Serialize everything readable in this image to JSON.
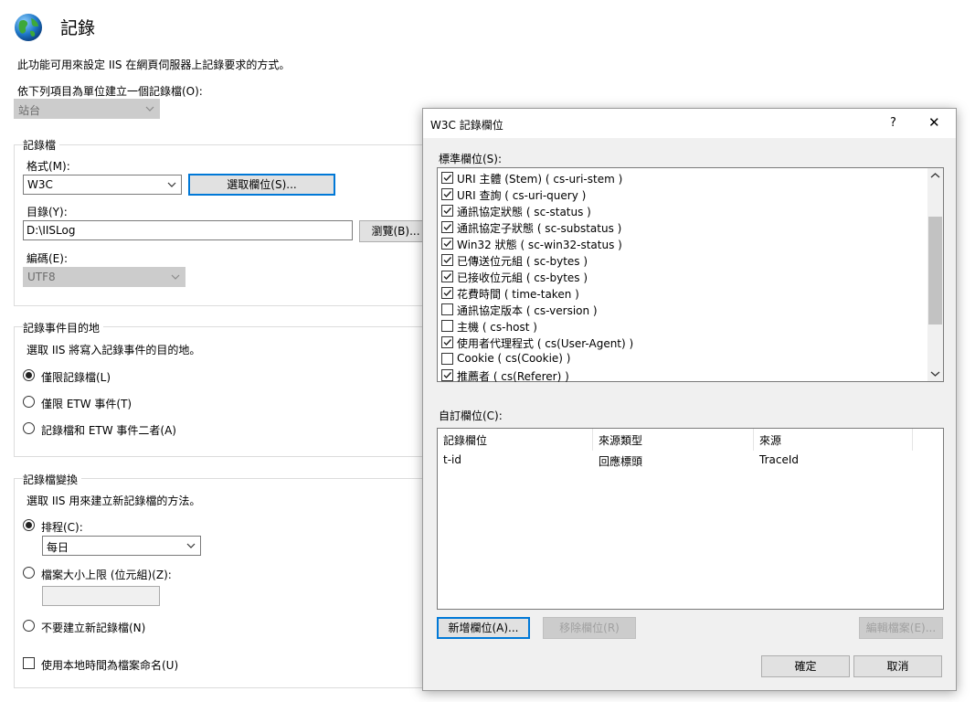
{
  "page": {
    "title": "記錄",
    "description": "此功能可用來設定 IIS 在網頁伺服器上記錄要求的方式。",
    "one_log_label": "依下列項目為單位建立一個記錄檔(O):",
    "one_log_value": "站台"
  },
  "log_file": {
    "legend": "記錄檔",
    "format_label": "格式(M):",
    "format_value": "W3C",
    "select_fields_button": "選取欄位(S)...",
    "directory_label": "目錄(Y):",
    "directory_value": "D:\\IISLog",
    "browse_button": "瀏覽(B)...",
    "encoding_label": "編碼(E):",
    "encoding_value": "UTF8"
  },
  "destination": {
    "legend": "記錄事件目的地",
    "description": "選取 IIS 將寫入記錄事件的目的地。",
    "options": [
      {
        "label": "僅限記錄檔(L)",
        "selected": true
      },
      {
        "label": "僅限 ETW 事件(T)",
        "selected": false
      },
      {
        "label": "記錄檔和 ETW 事件二者(A)",
        "selected": false
      }
    ]
  },
  "rollover": {
    "legend": "記錄檔變換",
    "description": "選取 IIS 用來建立新記錄檔的方法。",
    "schedule_label": "排程(C):",
    "schedule_value": "每日",
    "max_size_label": "檔案大小上限 (位元組)(Z):",
    "no_new_label": "不要建立新記錄檔(N)",
    "local_time_label": "使用本地時間為檔案命名(U)",
    "selected": "schedule",
    "local_time_checked": false
  },
  "dialog": {
    "title": "W3C 記錄欄位",
    "help_glyph": "?",
    "close_glyph": "✕",
    "standard_label": "標準欄位(S):",
    "standard_fields": [
      {
        "label": "URI 主體 (Stem) ( cs-uri-stem )",
        "checked": true
      },
      {
        "label": "URI 查詢 ( cs-uri-query )",
        "checked": true
      },
      {
        "label": "通訊協定狀態 ( sc-status )",
        "checked": true
      },
      {
        "label": "通訊協定子狀態 ( sc-substatus )",
        "checked": true
      },
      {
        "label": "Win32 狀態 ( sc-win32-status )",
        "checked": true
      },
      {
        "label": "已傳送位元組 ( sc-bytes )",
        "checked": true
      },
      {
        "label": "已接收位元組 ( cs-bytes )",
        "checked": true
      },
      {
        "label": "花費時間 ( time-taken )",
        "checked": true
      },
      {
        "label": "通訊協定版本 ( cs-version )",
        "checked": false
      },
      {
        "label": "主機 ( cs-host )",
        "checked": false
      },
      {
        "label": "使用者代理程式 ( cs(User-Agent) )",
        "checked": true
      },
      {
        "label": "Cookie ( cs(Cookie) )",
        "checked": false
      },
      {
        "label": "推薦者 ( cs(Referer) )",
        "checked": true
      }
    ],
    "scroll_position": 0.45,
    "custom_label": "自訂欄位(C):",
    "custom_columns": [
      "記錄欄位",
      "來源類型",
      "來源"
    ],
    "custom_rows": [
      [
        "t-id",
        "回應標頭",
        "TraceId"
      ]
    ],
    "add_button": "新增欄位(A)...",
    "remove_button": "移除欄位(R)",
    "edit_button": "編輯檔案(E)...",
    "ok_button": "確定",
    "cancel_button": "取消"
  },
  "colors": {
    "accent": "#0078d7",
    "dialog_bg": "#f0f0f0",
    "disabled_bg": "#cccccc"
  },
  "icons": {
    "page": "globe-icon",
    "dropdown": "chevron-down-icon",
    "close": "close-icon",
    "help": "help-icon"
  }
}
